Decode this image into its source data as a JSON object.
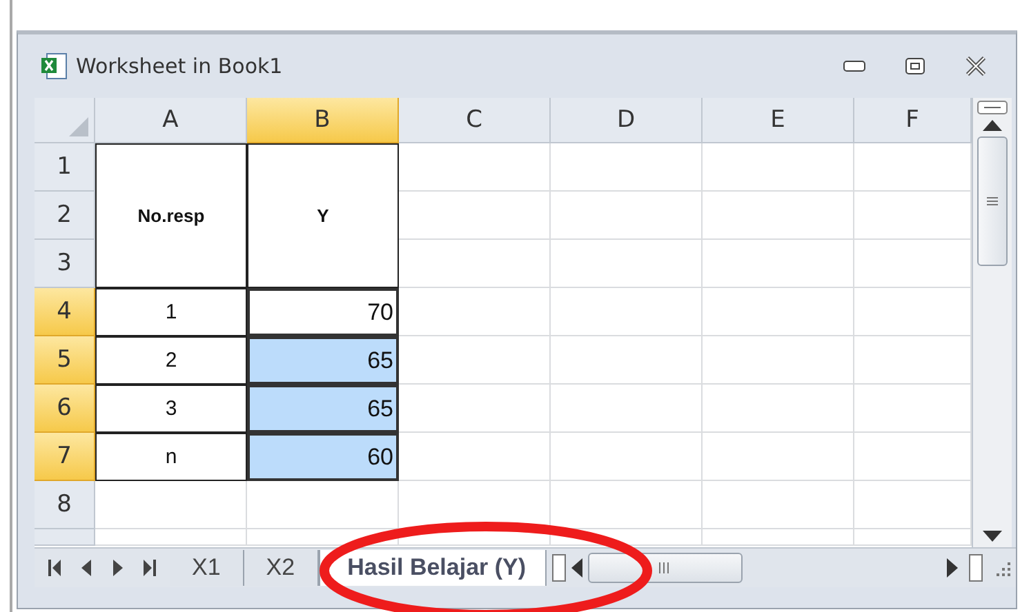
{
  "window": {
    "title": "Worksheet in Book1"
  },
  "columns": [
    {
      "label": "A",
      "selected": false
    },
    {
      "label": "B",
      "selected": true
    },
    {
      "label": "C",
      "selected": false
    },
    {
      "label": "D",
      "selected": false
    },
    {
      "label": "E",
      "selected": false
    },
    {
      "label": "F",
      "selected": false
    }
  ],
  "row_headers": [
    {
      "label": "1",
      "selected": false
    },
    {
      "label": "2",
      "selected": false
    },
    {
      "label": "3",
      "selected": false
    },
    {
      "label": "4",
      "selected": true
    },
    {
      "label": "5",
      "selected": true
    },
    {
      "label": "6",
      "selected": true
    },
    {
      "label": "7",
      "selected": true
    },
    {
      "label": "8",
      "selected": false
    }
  ],
  "table": {
    "headers": [
      "No.resp",
      "Y"
    ],
    "rows": [
      {
        "cells": [
          {
            "text": "1",
            "selected": false
          },
          {
            "text": "70",
            "selected": false
          }
        ]
      },
      {
        "cells": [
          {
            "text": "2",
            "selected": false
          },
          {
            "text": "65",
            "selected": true
          }
        ]
      },
      {
        "cells": [
          {
            "text": "3",
            "selected": false
          },
          {
            "text": "65",
            "selected": true
          }
        ]
      },
      {
        "cells": [
          {
            "text": "n",
            "selected": false
          },
          {
            "text": "60",
            "selected": true
          }
        ]
      }
    ]
  },
  "sheet_tabs": [
    {
      "label": "X1",
      "selected": false
    },
    {
      "label": "X2",
      "selected": false
    },
    {
      "label": "Hasil Belajar (Y)",
      "selected": true
    }
  ],
  "annotation": {
    "kind": "ellipse",
    "color": "#ee1c1c"
  }
}
